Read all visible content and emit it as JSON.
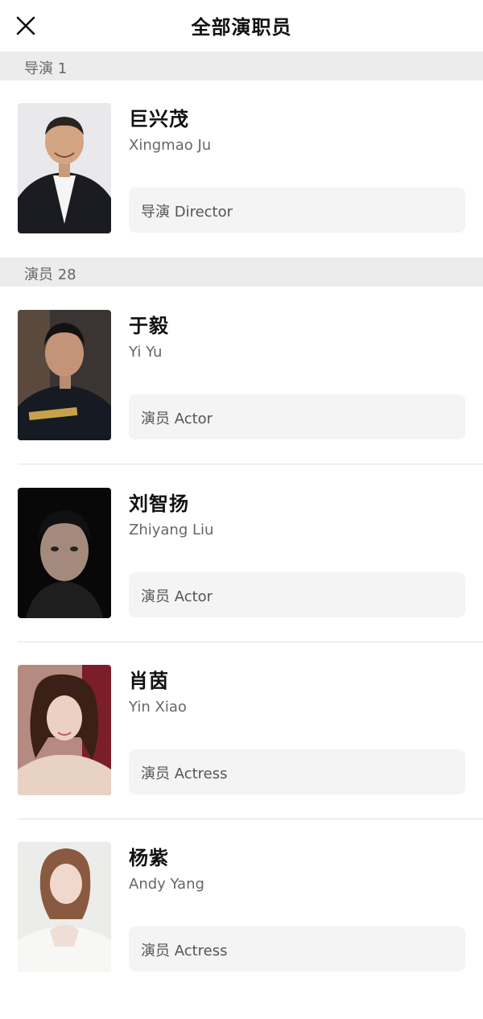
{
  "header": {
    "title": "全部演职员",
    "close_icon": "close-icon"
  },
  "sections": [
    {
      "label": "导演 1",
      "people": [
        {
          "name_cn": "巨兴茂",
          "name_en": "Xingmao Ju",
          "role": "导演 Director"
        }
      ]
    },
    {
      "label": "演员 28",
      "people": [
        {
          "name_cn": "于毅",
          "name_en": "Yi Yu",
          "role": "演员 Actor"
        },
        {
          "name_cn": "刘智扬",
          "name_en": "Zhiyang Liu",
          "role": "演员 Actor"
        },
        {
          "name_cn": "肖茵",
          "name_en": "Yin Xiao",
          "role": "演员 Actress"
        },
        {
          "name_cn": "杨紫",
          "name_en": "Andy Yang",
          "role": "演员 Actress"
        }
      ]
    }
  ],
  "colors": {
    "section_bg": "#ececec",
    "role_box_bg": "#f4f4f4",
    "divider": "#e2e2e2"
  }
}
